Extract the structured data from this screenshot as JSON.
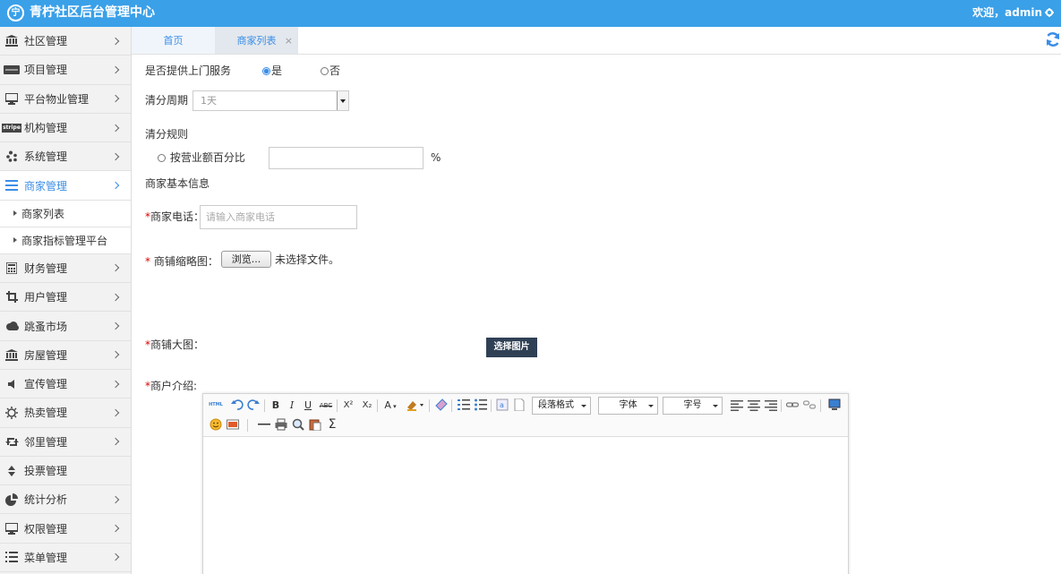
{
  "header": {
    "logo_glyph": "宁",
    "title": "青柠社区后台管理中心",
    "welcome": "欢迎，admin",
    "bg_color": "#3aa0e8"
  },
  "sidebar": {
    "items": [
      {
        "label": "社区管理",
        "icon": "bank-icon"
      },
      {
        "label": "项目管理",
        "icon": "card-icon"
      },
      {
        "label": "平台物业管理",
        "icon": "monitor-icon"
      },
      {
        "label": "机构管理",
        "icon": "stripe-icon",
        "badge": "stripe"
      },
      {
        "label": "系统管理",
        "icon": "yelp-icon"
      },
      {
        "label": "商家管理",
        "icon": "list-icon",
        "active": true
      },
      {
        "label": "财务管理",
        "icon": "calculator-icon"
      },
      {
        "label": "用户管理",
        "icon": "crop-icon"
      },
      {
        "label": "跳蚤市场",
        "icon": "cloud-icon"
      },
      {
        "label": "房屋管理",
        "icon": "bank-icon"
      },
      {
        "label": "宣传管理",
        "icon": "volume-icon"
      },
      {
        "label": "热卖管理",
        "icon": "sun-icon"
      },
      {
        "label": "邻里管理",
        "icon": "retweet-icon"
      },
      {
        "label": "投票管理",
        "icon": "sort-icon"
      },
      {
        "label": "统计分析",
        "icon": "pie-chart-icon"
      },
      {
        "label": "权限管理",
        "icon": "monitor-icon"
      },
      {
        "label": "菜单管理",
        "icon": "list-alt-icon"
      }
    ],
    "sub_items": [
      "商家列表",
      "商家指标管理平台"
    ]
  },
  "tabs": {
    "home": "首页",
    "merchant_list": "商家列表",
    "close": "×"
  },
  "form": {
    "door_service_label": "是否提供上门服务",
    "door_yes": "是",
    "door_no": "否",
    "door_selected": "yes",
    "cycle_label": "清分周期",
    "cycle_value": "1天",
    "rule_label": "清分规则",
    "rule_option": "按营业额百分比",
    "rule_percent_value": "",
    "percent_sign": "%",
    "basic_info_label": "商家基本信息",
    "required_mark": "*",
    "phone_label": "商家电话：",
    "phone_placeholder": "请输入商家电话",
    "thumb_label": " 商铺缩略图：",
    "browse_button": "浏览...",
    "no_file": "未选择文件。",
    "big_image_label": "商铺大图：",
    "pick_image_button": "选择图片",
    "intro_label": "商户介绍:"
  },
  "editor": {
    "html_label": "HTML",
    "bold": "B",
    "italic": "I",
    "underline": "U",
    "strike": "ABC",
    "superscript": "X²",
    "subscript": "X₂",
    "font_color": "A",
    "sum": "Σ",
    "paragraph_select": "段落格式",
    "font_select": "字体",
    "size_select": "字号",
    "content": ""
  }
}
